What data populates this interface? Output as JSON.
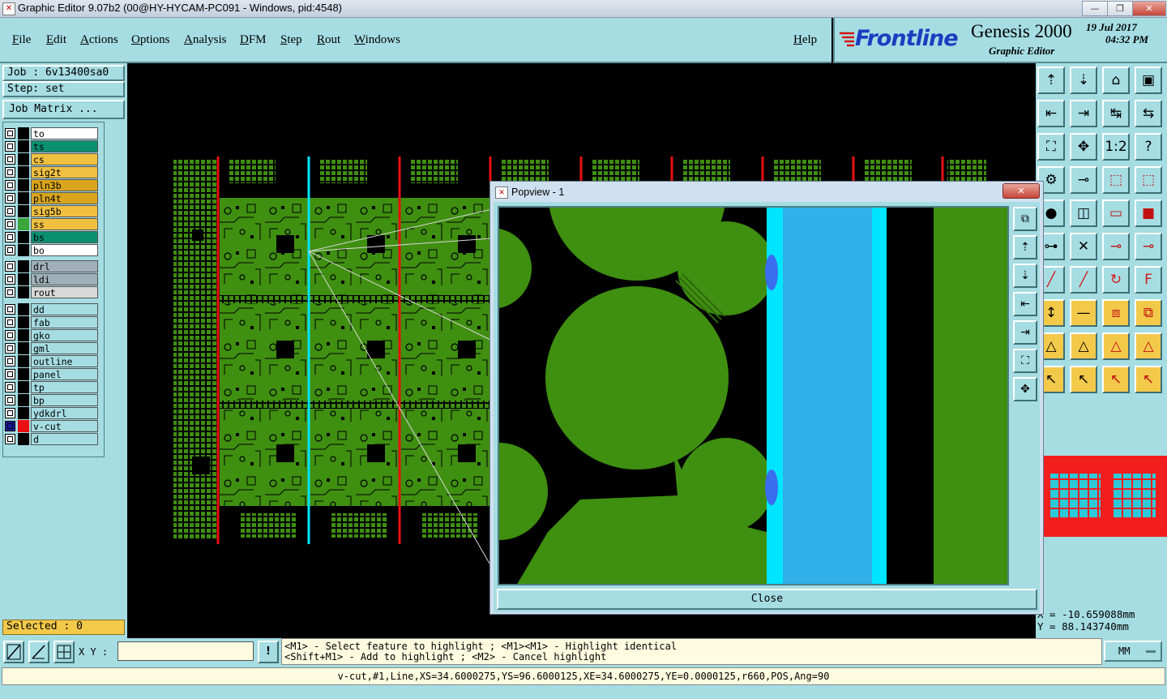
{
  "window": {
    "title": "Graphic Editor 9.07b2 (00@HY-HYCAM-PC091 - Windows, pid:4548)",
    "minimize_label": "—",
    "restore_label": "❐",
    "close_label": "✕"
  },
  "menu": {
    "items": [
      "File",
      "Edit",
      "Actions",
      "Options",
      "Analysis",
      "DFM",
      "Step",
      "Rout",
      "Windows"
    ],
    "help": "Help"
  },
  "brand": {
    "logo": "Frontline",
    "product": "Genesis 2000",
    "subtitle": "Graphic Editor",
    "date": "19 Jul 2017",
    "time": "04:32 PM"
  },
  "job": {
    "job_label": "Job : 6v13400sa0",
    "step_label": "Step: set",
    "matrix_button": "Job Matrix ..."
  },
  "layers_group1": [
    {
      "name": "to",
      "bg": "#ffffff",
      "swatch": "#000000"
    },
    {
      "name": "ts",
      "bg": "#0a8f6f",
      "swatch": "#000000"
    },
    {
      "name": "cs",
      "bg": "#f0c040",
      "swatch": "#000000"
    },
    {
      "name": "sig2t",
      "bg": "#f0c040",
      "swatch": "#000000"
    },
    {
      "name": "pln3b",
      "bg": "#d9a51c",
      "swatch": "#000000"
    },
    {
      "name": "pln4t",
      "bg": "#d9a51c",
      "swatch": "#000000"
    },
    {
      "name": "sig5b",
      "bg": "#f0c040",
      "swatch": "#000000"
    },
    {
      "name": "ss",
      "bg": "#f0c040",
      "swatch": "#3aa53a"
    },
    {
      "name": "bs",
      "bg": "#0a8f6f",
      "swatch": "#000000"
    },
    {
      "name": "bo",
      "bg": "#ffffff",
      "swatch": "#000000"
    }
  ],
  "layers_group2": [
    {
      "name": "drl",
      "bg": "#9fb0b8",
      "swatch": "#000000"
    },
    {
      "name": "ldi",
      "bg": "#9fb0b8",
      "swatch": "#000000"
    },
    {
      "name": "rout",
      "bg": "#d8d8d8",
      "swatch": "#000000"
    }
  ],
  "layers_group3": [
    {
      "name": "dd",
      "bg": "#a5dde3",
      "swatch": "#000000"
    },
    {
      "name": "fab",
      "bg": "#a5dde3",
      "swatch": "#000000"
    },
    {
      "name": "gko",
      "bg": "#a5dde3",
      "swatch": "#000000"
    },
    {
      "name": "gml",
      "bg": "#a5dde3",
      "swatch": "#000000"
    },
    {
      "name": "outline",
      "bg": "#a5dde3",
      "swatch": "#000000"
    },
    {
      "name": "panel",
      "bg": "#a5dde3",
      "swatch": "#000000"
    },
    {
      "name": "tp",
      "bg": "#a5dde3",
      "swatch": "#000000"
    },
    {
      "name": "bp",
      "bg": "#a5dde3",
      "swatch": "#000000"
    },
    {
      "name": "ydkdrl",
      "bg": "#a5dde3",
      "swatch": "#000000"
    },
    {
      "name": "v-cut",
      "bg": "#a5dde3",
      "swatch": "#e81010",
      "active": true
    },
    {
      "name": "d",
      "bg": "#a5dde3",
      "swatch": "#000000"
    }
  ],
  "selected_label": "Selected : 0",
  "popview": {
    "title": "Popview - 1",
    "close_button": "Close"
  },
  "coords": {
    "x": "X = -10.659088mm",
    "y": "Y = 88.143740mm"
  },
  "prompt": {
    "xy_label": "X Y :",
    "xy_value": "",
    "warn": "!",
    "line1": "<M1> - Select feature to highlight ; <M1><M1> - Highlight identical",
    "line2": "<Shift+M1> - Add to highlight ; <M2> - Cancel highlight",
    "units": "MM"
  },
  "status_line": "v-cut,#1,Line,XS=34.6000275,YS=96.6000125,XE=34.6000275,YE=0.0000125,r660,POS,Ang=90",
  "colors": {
    "panel_bg": "#a5dde3",
    "copper": "#3f8f10",
    "vcut_red": "#e81010",
    "vcut_cyan": "#00e5ff",
    "selected_bar": "#f3c94a"
  }
}
